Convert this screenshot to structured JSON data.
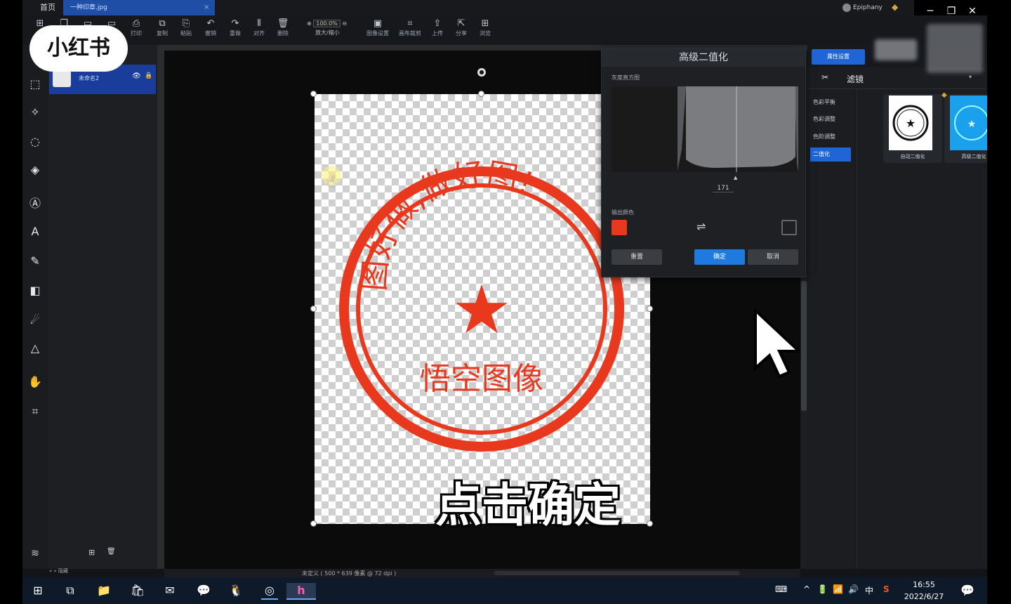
{
  "tabs": {
    "home": "首页",
    "file": "一种印章.jpg",
    "close": "×"
  },
  "brand": {
    "name": "Epiphany"
  },
  "window": {
    "min": "─",
    "max": "❐",
    "close": "✕"
  },
  "toolbar": {
    "items": [
      {
        "icon": "⊞",
        "label": ""
      },
      {
        "icon": "❐",
        "label": ""
      },
      {
        "icon": "▭",
        "label": ""
      },
      {
        "icon": "▭",
        "label": ""
      },
      {
        "icon": "⎙",
        "label": "打印"
      },
      {
        "icon": "⧉",
        "label": "复制"
      },
      {
        "icon": "⎘",
        "label": "粘贴"
      },
      {
        "icon": "↶",
        "label": "撤销"
      },
      {
        "icon": "↷",
        "label": "重做"
      },
      {
        "icon": "⫴",
        "label": "对齐"
      },
      {
        "icon": "🗑",
        "label": "删除"
      }
    ],
    "zoom_value": "100.0%",
    "zoom_label": "放大/缩小",
    "items2": [
      {
        "icon": "▣",
        "label": "图像设置"
      },
      {
        "icon": "⌗",
        "label": "画布裁剪"
      },
      {
        "icon": "⇪",
        "label": "上传"
      },
      {
        "icon": "⇱",
        "label": "分享"
      },
      {
        "icon": "⊞",
        "label": "浏览"
      }
    ]
  },
  "watermark": "小红书",
  "layers": {
    "name": "未命名2",
    "eye": "👁",
    "lock": "🔒",
    "add": "⊞",
    "delete": "🗑",
    "collapse": "« « 隐藏"
  },
  "stamp": {
    "arc_text": "图好做,做好图!",
    "center": "★",
    "bottom": "悟空图像"
  },
  "caption": "点击确定",
  "status": {
    "doc_info": "未定义 ( 500 * 639 像素 @ 72 dpi )"
  },
  "right_panel": {
    "tab_label": "属性设置",
    "filter_title": "滤镜",
    "filter_icon": "✂",
    "dropdown": "▾",
    "categories": [
      "色彩平衡",
      "色彩调整",
      "色阶调整",
      "二值化"
    ],
    "active_category": "二值化",
    "cards": [
      {
        "label": "自动二值化",
        "bg": "#ffffff"
      },
      {
        "label": "高级二值化",
        "bg": "#1aa0ec"
      }
    ]
  },
  "dialog": {
    "title": "高级二值化",
    "histogram_label": "灰度直方图",
    "threshold": "171",
    "output_label": "输出颜色",
    "swap_icon": "⇌",
    "fg_color": "#e8391f",
    "reset": "重置",
    "confirm": "确定",
    "cancel": "取消"
  },
  "taskbar": {
    "start_icon": "⊞",
    "apps": [
      "⧉",
      "📁",
      "🛍",
      "✉",
      "💬",
      "🐧",
      "◎",
      "h"
    ],
    "tray": [
      "⌨",
      "^",
      "🔋",
      "📶",
      "🔊",
      "中",
      "S"
    ],
    "time": "16:55",
    "date": "2022/6/27",
    "notify": "💬"
  }
}
